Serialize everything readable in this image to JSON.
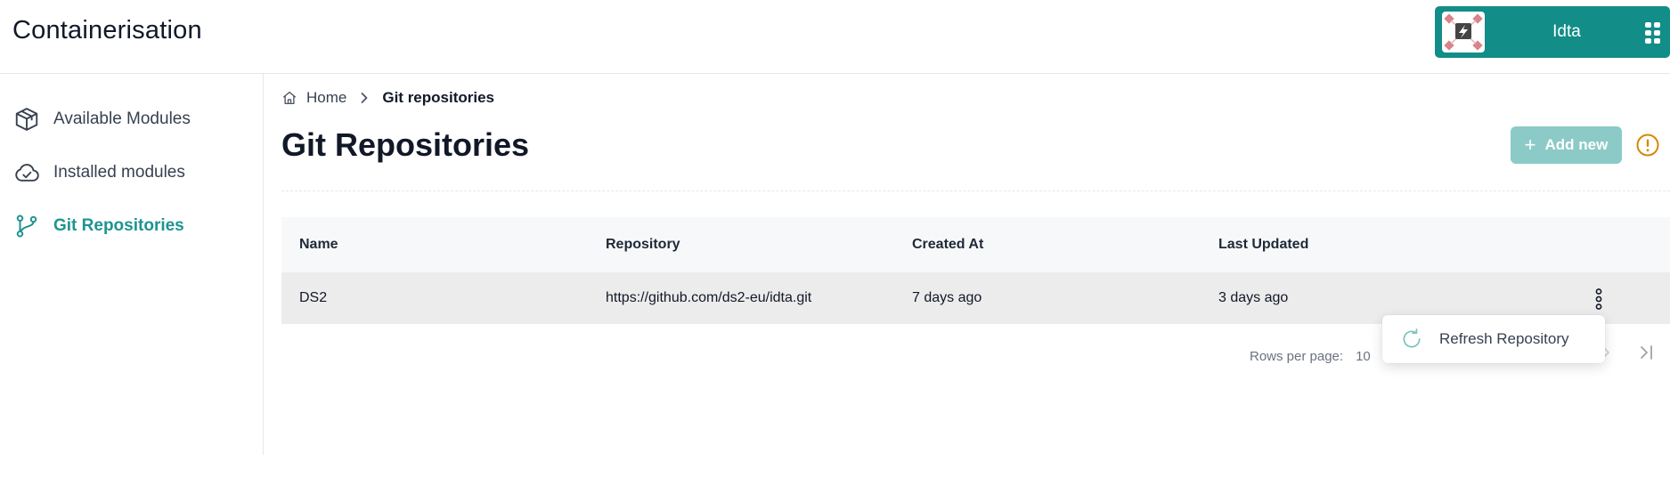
{
  "app": {
    "title": "Containerisation"
  },
  "user": {
    "name": "Idta"
  },
  "sidebar": {
    "items": [
      {
        "label": "Available Modules",
        "icon": "box-icon",
        "active": false
      },
      {
        "label": "Installed modules",
        "icon": "cloud-check-icon",
        "active": false
      },
      {
        "label": "Git Repositories",
        "icon": "git-branch-icon",
        "active": true
      }
    ]
  },
  "breadcrumb": {
    "home": "Home",
    "current": "Git repositories"
  },
  "page": {
    "title": "Git Repositories",
    "add_label": "Add new",
    "add_icon": "plus-icon",
    "warning_icon": "alert-circle-icon"
  },
  "table": {
    "columns": [
      "Name",
      "Repository",
      "Created At",
      "Last Updated"
    ],
    "rows": [
      {
        "name": "DS2",
        "repository": "https://github.com/ds2-eu/idta.git",
        "created_at": "7 days ago",
        "last_updated": "3 days ago"
      }
    ]
  },
  "pagination": {
    "rows_per_page_label": "Rows per page:",
    "rows_per_page": "10"
  },
  "row_menu": {
    "items": [
      {
        "label": "Refresh Repository",
        "icon": "refresh-icon"
      }
    ]
  },
  "colors": {
    "brand": "#138d88",
    "accent": "#1f948f",
    "button_disabled": "#8ccac7",
    "warning": "#d48806",
    "row_hover": "#ececec",
    "header_bg": "#f7f8fa"
  }
}
